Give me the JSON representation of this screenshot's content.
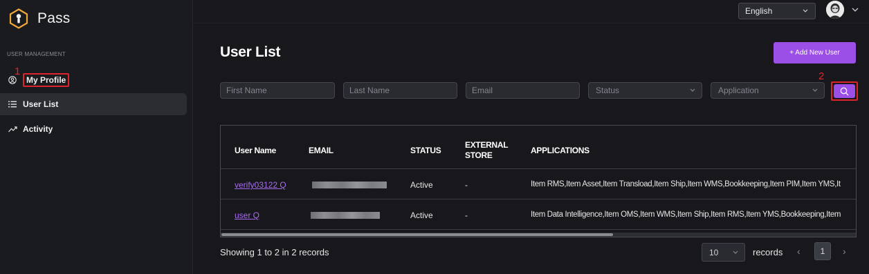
{
  "app": {
    "name": "Pass"
  },
  "sidebar": {
    "section_label": "USER MANAGEMENT",
    "items": [
      {
        "label": "My Profile",
        "icon": "user-circle-icon",
        "active": false,
        "highlighted": true
      },
      {
        "label": "User List",
        "icon": "list-icon",
        "active": true,
        "highlighted": false
      },
      {
        "label": "Activity",
        "icon": "trend-icon",
        "active": false,
        "highlighted": false
      }
    ]
  },
  "header": {
    "language": "English",
    "avatar_icon": "user-avatar-icon"
  },
  "annotations": {
    "step1": "1",
    "step2": "2"
  },
  "page": {
    "title": "User List",
    "add_button": "+ Add New User"
  },
  "filters": {
    "first_name_placeholder": "First Name",
    "last_name_placeholder": "Last Name",
    "email_placeholder": "Email",
    "status_placeholder": "Status",
    "application_placeholder": "Application"
  },
  "table": {
    "columns": {
      "user_name": "User Name",
      "email": "EMAIL",
      "status": "STATUS",
      "external_store_line1": "EXTERNAL",
      "external_store_line2": "STORE",
      "applications": "APPLICATIONS"
    },
    "rows": [
      {
        "user_name": "verify03122 Q",
        "status": "Active",
        "external_store": "-",
        "applications": "Item RMS,Item Asset,Item Transload,Item Ship,Item WMS,Bookkeeping,Item PIM,Item YMS,It"
      },
      {
        "user_name": "user Q",
        "status": "Active",
        "external_store": "-",
        "applications": "Item Data Intelligence,Item OMS,Item WMS,Item Ship,Item RMS,Item YMS,Bookkeeping,Item"
      }
    ]
  },
  "footer": {
    "showing_text": "Showing 1 to 2 in 2 records",
    "page_size": "10",
    "records_label": "records",
    "prev": "‹",
    "next": "›",
    "current_page": "1"
  },
  "colors": {
    "accent": "#9b4fe6",
    "highlight": "#e0242b",
    "link": "#a66cf0"
  }
}
